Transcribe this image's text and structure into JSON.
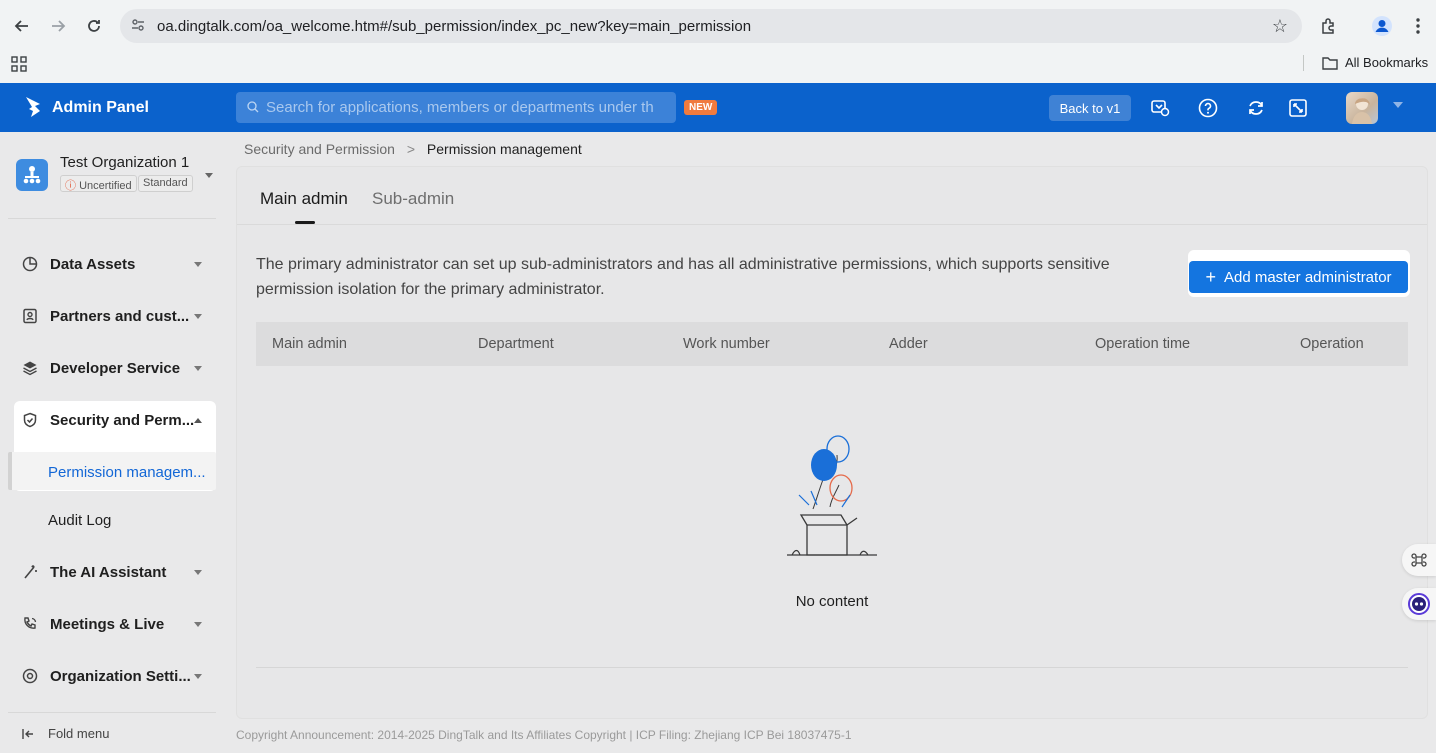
{
  "browser": {
    "url": "oa.dingtalk.com/oa_welcome.htm#/sub_permission/index_pc_new?key=main_permission",
    "bookmarks_label": "All Bookmarks"
  },
  "header": {
    "app_title": "Admin Panel",
    "search_placeholder": "Search for applications, members or departments under th",
    "new_badge": "NEW",
    "back_button": "Back to v1"
  },
  "sidebar": {
    "org_name": "Test Organization 1",
    "tag_uncertified": "Uncertified",
    "tag_standard": "Standard",
    "items": [
      {
        "label": "Data Assets",
        "icon": "data-assets-icon"
      },
      {
        "label": "Partners and cust...",
        "icon": "partners-icon"
      },
      {
        "label": "Developer Service",
        "icon": "layers-icon"
      },
      {
        "label": "Security and Perm...",
        "icon": "shield-icon"
      },
      {
        "label": "The AI Assistant",
        "icon": "magic-wand-icon"
      },
      {
        "label": "Meetings & Live",
        "icon": "meeting-icon"
      },
      {
        "label": "Organization Setti...",
        "icon": "settings-icon"
      }
    ],
    "sub_items": [
      "Permission managem...",
      "Audit Log"
    ],
    "fold_menu": "Fold menu"
  },
  "breadcrumb": {
    "parent": "Security and Permission",
    "separator": ">",
    "current": "Permission management"
  },
  "tabs": [
    "Main admin",
    "Sub-admin"
  ],
  "description": "The primary administrator can set up sub-administrators and has all administrative permissions, which supports sensitive permission isolation for the primary administrator.",
  "add_button": "Add master administrator",
  "table": {
    "columns": [
      "Main admin",
      "Department",
      "Work number",
      "Adder",
      "Operation time",
      "Operation"
    ]
  },
  "empty_text": "No content",
  "footer": "Copyright Announcement: 2014-2025 DingTalk and Its Affiliates Copyright | ICP Filing: Zhejiang ICP Bei 18037475-1",
  "colors": {
    "brand": "#0b62cc",
    "primary_button": "#1475e0",
    "active_link": "#1367d6"
  }
}
